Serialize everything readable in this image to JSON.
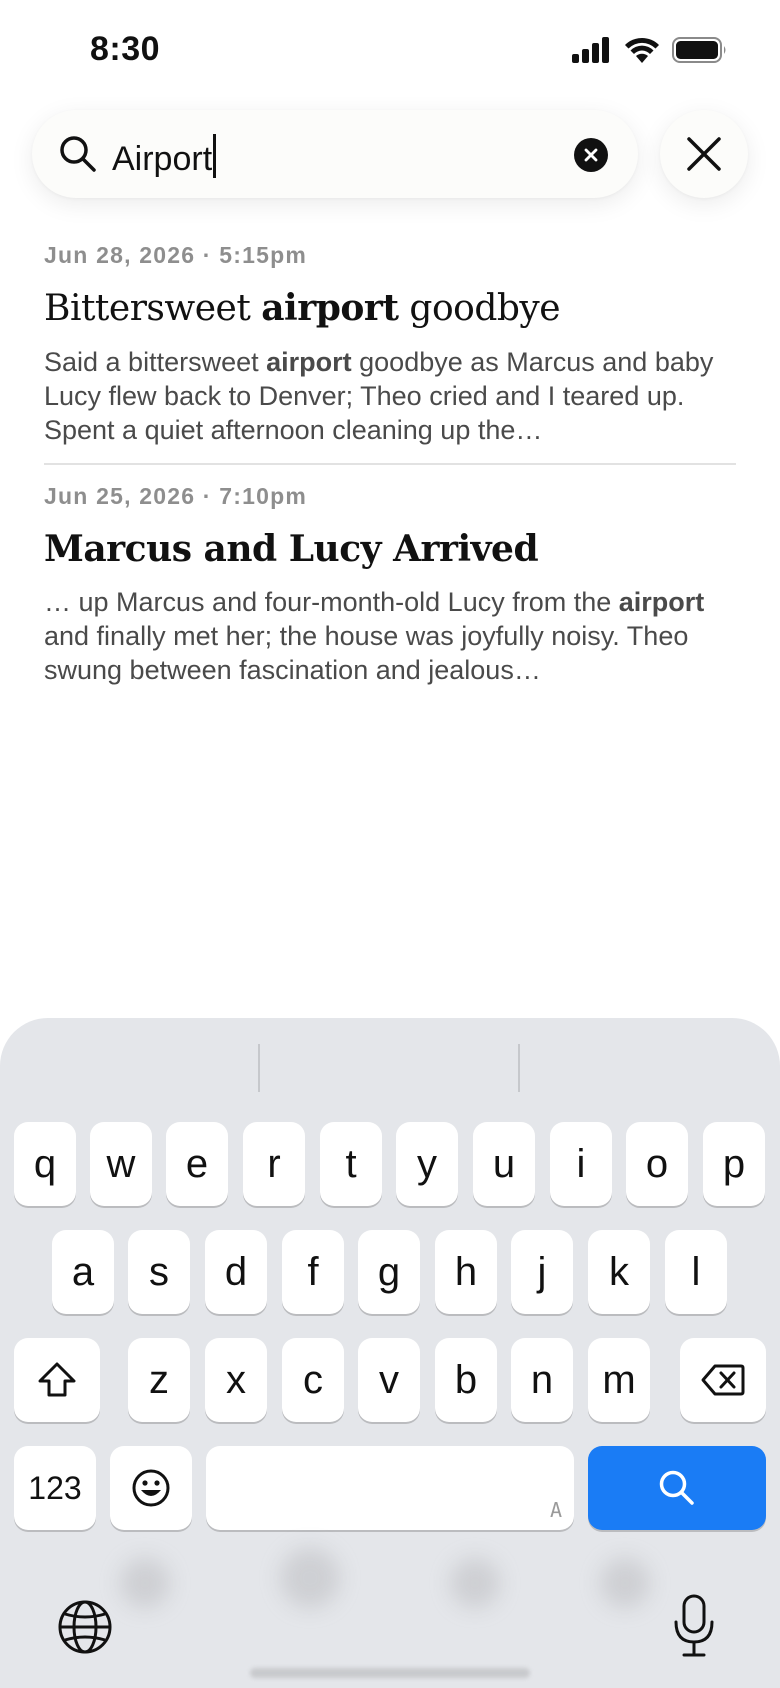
{
  "status_bar": {
    "time": "8:30"
  },
  "search": {
    "value": "Airport",
    "placeholder": ""
  },
  "results": [
    {
      "date": "Jun 28, 2026 · 5:15pm",
      "title_parts": [
        "Bittersweet ",
        "airport",
        " goodbye"
      ],
      "snippet_parts": [
        "Said a bittersweet ",
        "airport",
        " goodbye as Marcus and baby Lucy flew back to Denver; Theo cried and I teared up. Spent a quiet afternoon cleaning up the…"
      ]
    },
    {
      "date": "Jun 25, 2026 · 7:10pm",
      "title": "Marcus and Lucy Arrived",
      "snippet_parts": [
        "… up Marcus and four-month-old Lucy from the ",
        "airport",
        " and finally met her; the house was joyfully noisy. Theo swung between fascination and jealous…"
      ]
    }
  ],
  "keyboard": {
    "row1": [
      "q",
      "w",
      "e",
      "r",
      "t",
      "y",
      "u",
      "i",
      "o",
      "p"
    ],
    "row2": [
      "a",
      "s",
      "d",
      "f",
      "g",
      "h",
      "j",
      "k",
      "l"
    ],
    "row3": [
      "z",
      "x",
      "c",
      "v",
      "b",
      "n",
      "m"
    ],
    "numbers_label": "123",
    "space_hint": "A",
    "accent_color": "#1a7cf5"
  },
  "icons": {
    "search": "search-icon",
    "clear": "clear-circle-icon",
    "close": "close-icon",
    "shift": "shift-icon",
    "delete": "backspace-icon",
    "emoji": "emoji-icon",
    "globe": "globe-icon",
    "mic": "microphone-icon"
  }
}
